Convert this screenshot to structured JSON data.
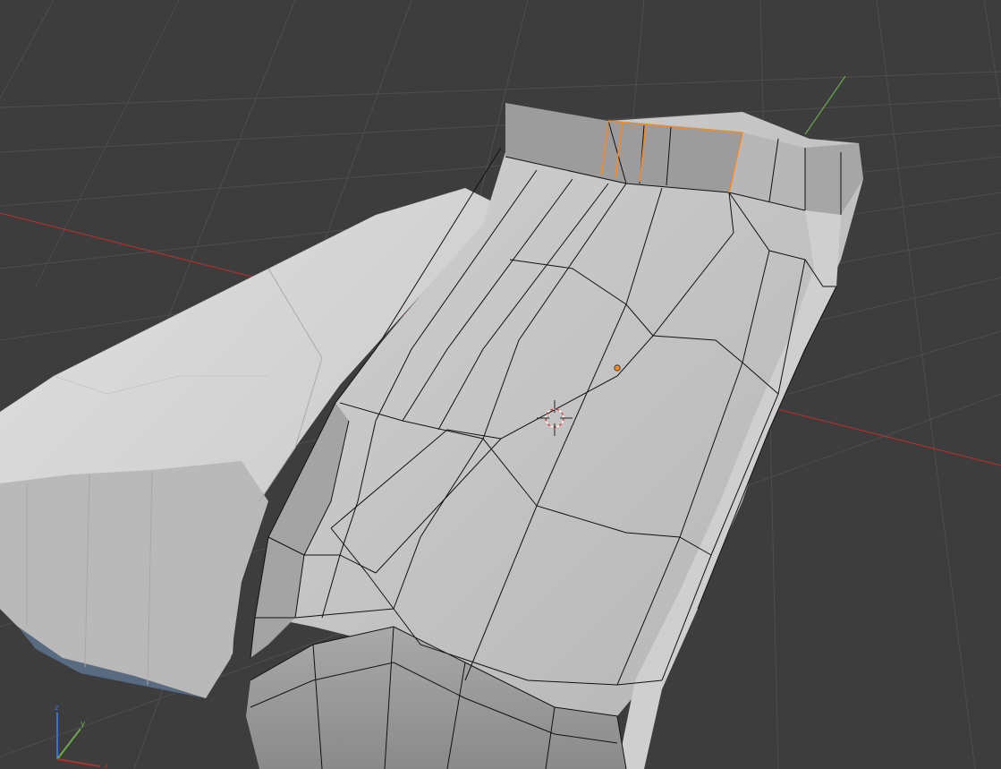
{
  "viewport": {
    "background": "#3d3d3d",
    "grid_color": "#4e4e4e",
    "mesh_base": "#bdbdbd",
    "mesh_highlight": "#d6d6d6",
    "mesh_shadow": "#8f8f8f",
    "wire_color": "#111111",
    "selection_color": "#f28c28"
  },
  "axes": {
    "x_color": "#a83232",
    "y_color": "#6aa84f",
    "z_color": "#3b6fd6"
  },
  "gizmo": {
    "x_label": "x",
    "y_label": "y",
    "z_label": "z"
  },
  "cursor": {
    "name": "3d-cursor"
  },
  "origin": {
    "name": "object-origin"
  }
}
